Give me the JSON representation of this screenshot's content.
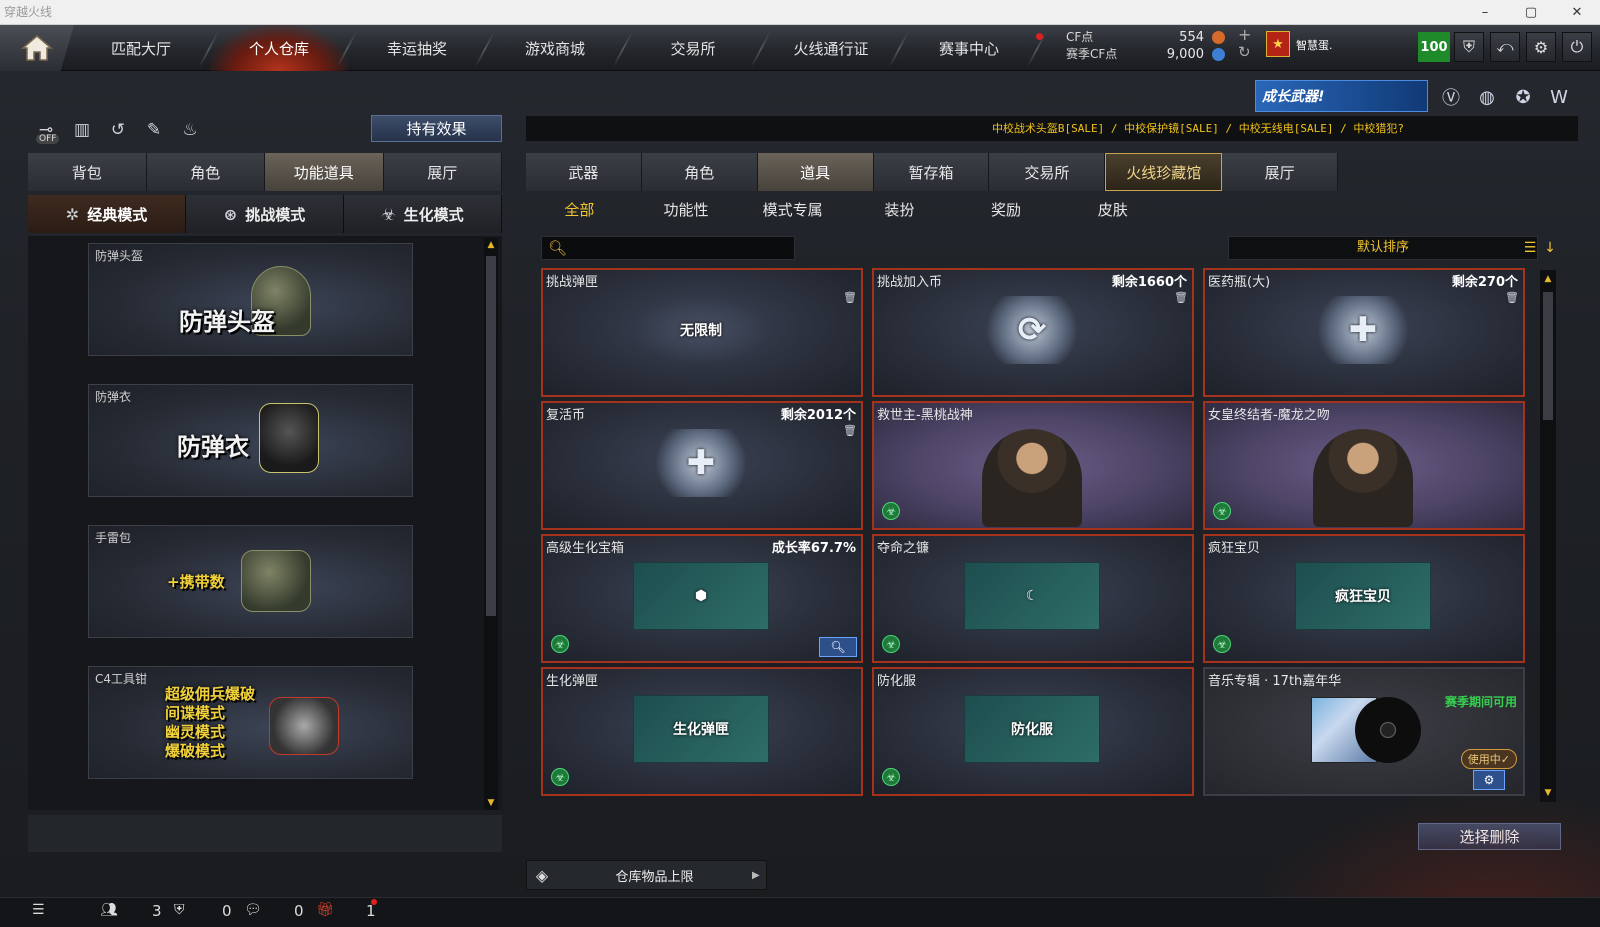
{
  "window": {
    "title": "穿越火线",
    "min": "–",
    "max": "▢",
    "close": "✕"
  },
  "topnav": {
    "home_icon": "home-icon",
    "tabs": [
      {
        "label": "匹配大厅",
        "active": false
      },
      {
        "label": "个人仓库",
        "active": true
      },
      {
        "label": "幸运抽奖",
        "active": false
      },
      {
        "label": "游戏商城",
        "active": false
      },
      {
        "label": "交易所",
        "active": false
      },
      {
        "label": "火线通行证",
        "active": false
      },
      {
        "label": "赛事中心",
        "active": false
      }
    ],
    "cf_label": "CF点",
    "season_cf_label": "赛季CF点",
    "cf_value": "554",
    "season_cf_value": "9,000",
    "plus": "+",
    "refresh": "↻",
    "rank_glyph": "★",
    "username": "智慧蛋.",
    "level": "100",
    "icons": [
      "shield-icon",
      "return-icon",
      "settings-icon",
      "power-icon"
    ]
  },
  "banner": {
    "text": "成长武器!"
  },
  "toolbar": {
    "off_label": "OFF",
    "hold_effect": "持有效果"
  },
  "ticker": "中校战术头盔B[SALE] / 中校保护镜[SALE] / 中校无线电[SALE] / 中校猎犯?",
  "left": {
    "tabs": [
      {
        "label": "背包",
        "active": false
      },
      {
        "label": "角色",
        "active": false
      },
      {
        "label": "功能道具",
        "active": true
      },
      {
        "label": "展厅",
        "active": false
      }
    ],
    "modes": [
      {
        "label": "经典模式",
        "active": true
      },
      {
        "label": "挑战模式",
        "active": false
      },
      {
        "label": "生化模式",
        "active": false
      }
    ],
    "cards": [
      {
        "name": "防弹头盔",
        "art": "防弹头盔"
      },
      {
        "name": "防弹衣",
        "art": "防弹衣"
      },
      {
        "name": "手雷包",
        "art": "+携带数"
      },
      {
        "name": "C4工具钳",
        "art": "超级佣兵爆破\n间谍模式\n幽灵模式\n爆破模式"
      }
    ]
  },
  "right": {
    "tabs": [
      {
        "label": "武器",
        "active": false
      },
      {
        "label": "角色",
        "active": false
      },
      {
        "label": "道具",
        "active": true
      },
      {
        "label": "暂存箱",
        "active": false
      },
      {
        "label": "交易所",
        "active": false
      },
      {
        "label": "火线珍藏馆",
        "active": false
      },
      {
        "label": "展厅",
        "active": false
      }
    ],
    "subtabs": [
      {
        "label": "全部",
        "active": true
      },
      {
        "label": "功能性",
        "active": false
      },
      {
        "label": "模式专属",
        "active": false
      },
      {
        "label": "装扮",
        "active": false
      },
      {
        "label": "奖励",
        "active": false
      },
      {
        "label": "皮肤",
        "active": false
      }
    ],
    "search_placeholder": "",
    "sort_label": "默认排序",
    "items": [
      {
        "name": "挑战弹匣",
        "info": "",
        "art": "无限制",
        "type": "ammo"
      },
      {
        "name": "挑战加入币",
        "info": "剩余1660个",
        "art": "⟳",
        "type": "coin"
      },
      {
        "name": "医药瓶(大)",
        "info": "剩余270个",
        "art": "✚",
        "type": "med"
      },
      {
        "name": "复活币",
        "info": "剩余2012个",
        "art": "✚",
        "type": "revive"
      },
      {
        "name": "救世主-黑桃战神",
        "info": "",
        "art": "",
        "type": "char"
      },
      {
        "name": "女皇终结者-魔龙之吻",
        "info": "",
        "art": "",
        "type": "char"
      },
      {
        "name": "高级生化宝箱",
        "info": "成长率67.7%",
        "art": "⬢",
        "type": "box"
      },
      {
        "name": "夺命之镰",
        "info": "",
        "art": "☾",
        "type": "bio"
      },
      {
        "name": "疯狂宝贝",
        "info": "",
        "art": "疯狂宝贝",
        "type": "bio"
      },
      {
        "name": "生化弹匣",
        "info": "",
        "art": "生化弹匣",
        "type": "bio"
      },
      {
        "name": "防化服",
        "info": "",
        "art": "防化服",
        "type": "bio"
      },
      {
        "name": "音乐专辑 · 17th嘉年华",
        "info": "",
        "art": "",
        "type": "music",
        "season_note": "赛季期间可用",
        "in_use": "使用中✓"
      }
    ],
    "select_delete": "选择删除",
    "capacity_label": "仓库物品上限"
  },
  "status": {
    "friends_count": "3",
    "clan_count": "0",
    "chat_count": "0",
    "gift_count": "1"
  },
  "colors": {
    "accent_red": "#a5321c",
    "gold": "#f2c630",
    "level_green": "#1f8a2a"
  }
}
